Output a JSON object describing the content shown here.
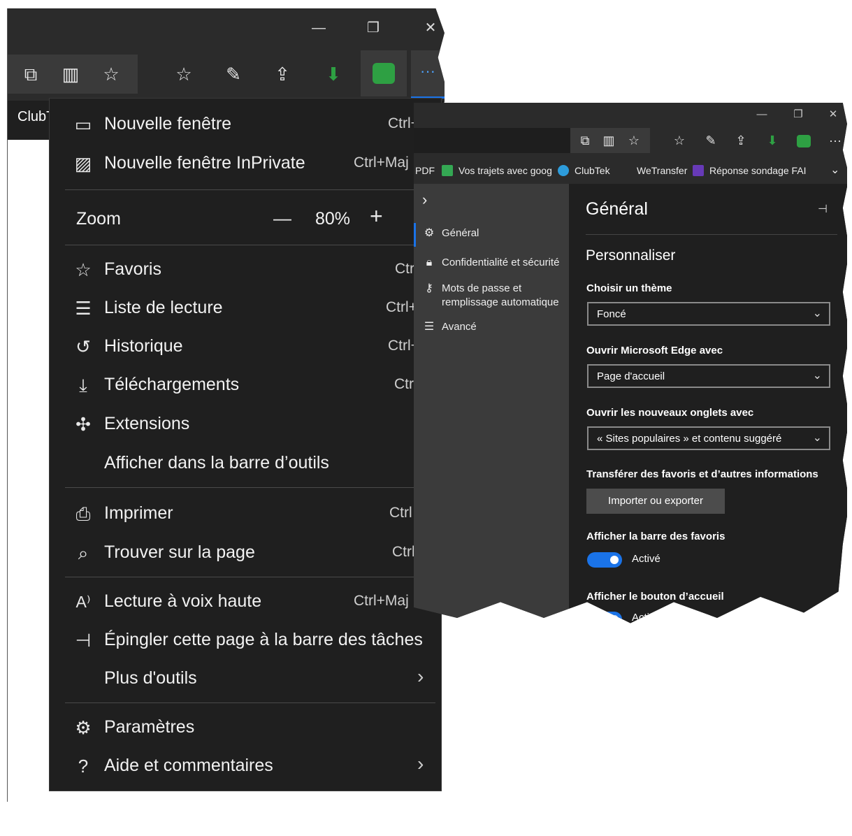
{
  "back": {
    "tab_label": "ClubT",
    "window_controls": {
      "minimize": "—",
      "restore": "❐",
      "close": "✕"
    },
    "toolbar_more": "···"
  },
  "menu": {
    "items": [
      {
        "label": "Nouvelle fenêtre",
        "shortcut": "Ctrl+"
      },
      {
        "label": "Nouvelle fenêtre InPrivate",
        "shortcut": "Ctrl+Maj"
      },
      {
        "label": "Favoris",
        "shortcut": "Ctr"
      },
      {
        "label": "Liste de lecture",
        "shortcut": "Ctrl+"
      },
      {
        "label": "Historique",
        "shortcut": "Ctrl+"
      },
      {
        "label": "Téléchargements",
        "shortcut": "Ctr"
      },
      {
        "label": "Extensions",
        "shortcut": ""
      },
      {
        "label": "Afficher dans la barre d’outils",
        "shortcut": ""
      },
      {
        "label": "Imprimer",
        "shortcut": "Ctrl"
      },
      {
        "label": "Trouver sur la page",
        "shortcut": "Ctrl"
      },
      {
        "label": "Lecture à voix haute",
        "shortcut": "Ctrl+Maj"
      },
      {
        "label": "Épingler cette page à la barre des tâches",
        "shortcut": ""
      },
      {
        "label": "Plus d'outils",
        "shortcut": ""
      },
      {
        "label": "Paramètres",
        "shortcut": ""
      },
      {
        "label": "Aide et commentaires",
        "shortcut": ""
      }
    ],
    "zoom": {
      "label": "Zoom",
      "minus": "—",
      "value": "80%",
      "plus": "+"
    }
  },
  "front": {
    "window_controls": {
      "minimize": "—",
      "restore": "❐",
      "close": "✕"
    },
    "toolbar_more": "···",
    "favorites_bar": [
      {
        "label": "PDF",
        "color": ""
      },
      {
        "label": "Vos trajets avec goog",
        "color": "#34a853"
      },
      {
        "label": "ClubTek",
        "color": "#2d9cdb"
      },
      {
        "label": "WeTransfer",
        "color": ""
      },
      {
        "label": "Réponse sondage FAI",
        "color": "#673ab7"
      }
    ],
    "favorites_more": "⌄",
    "nav": {
      "expand": "›",
      "items": [
        {
          "label": "Général"
        },
        {
          "label": "Confidentialité et sécurité"
        },
        {
          "label": "Mots de passe et",
          "label2": "remplissage automatique"
        },
        {
          "label": "Avancé"
        }
      ]
    },
    "settings": {
      "title": "Général",
      "section": "Personnaliser",
      "theme_label": "Choisir un thème",
      "theme_value": "Foncé",
      "open_with_label": "Ouvrir Microsoft Edge avec",
      "open_with_value": "Page d'accueil",
      "new_tabs_label": "Ouvrir les nouveaux onglets avec",
      "new_tabs_value": "« Sites populaires » et contenu suggéré",
      "transfer_label": "Transférer des favoris et d’autres informations",
      "transfer_button": "Importer ou exporter",
      "favbar_label": "Afficher la barre des favoris",
      "favbar_state": "Activé",
      "home_label": "Afficher le bouton d’accueil",
      "home_state": "Activé"
    },
    "colors": {
      "accent": "#1a73e8",
      "download_green": "#2ea043"
    }
  }
}
